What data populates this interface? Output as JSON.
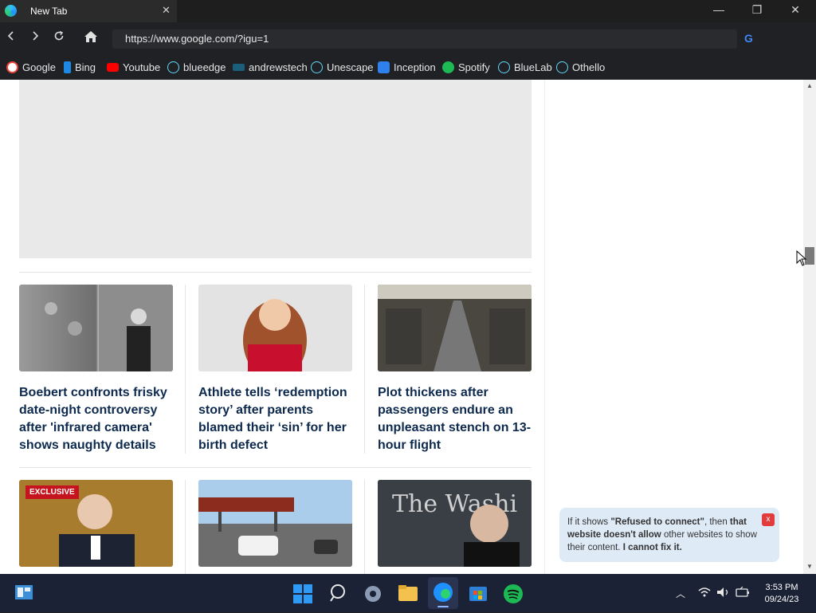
{
  "browser": {
    "tab_title": "New Tab",
    "url": "https://www.google.com/?igu=1"
  },
  "bookmarks": [
    {
      "label": "Google",
      "icon": "google-icon",
      "color": "#ea4335"
    },
    {
      "label": "Bing",
      "icon": "bing-icon",
      "color": "#1e88e5"
    },
    {
      "label": "Youtube",
      "icon": "youtube-icon",
      "color": "#ff0000"
    },
    {
      "label": "blueedge",
      "icon": "react-icon",
      "color": "#61dafb"
    },
    {
      "label": "andrewstech",
      "icon": "andrewstech-icon",
      "color": "#1b5f7a"
    },
    {
      "label": "Unescape",
      "icon": "react-icon",
      "color": "#61dafb"
    },
    {
      "label": "Inception",
      "icon": "inception-icon",
      "color": "#2f80ed"
    },
    {
      "label": "Spotify",
      "icon": "spotify-icon",
      "color": "#1db954"
    },
    {
      "label": "BlueLab",
      "icon": "react-icon",
      "color": "#61dafb"
    },
    {
      "label": "Othello",
      "icon": "react-icon",
      "color": "#61dafb"
    }
  ],
  "articles": [
    {
      "title": "Boebert confronts frisky date-night controversy after 'infrared camera' shows naughty details"
    },
    {
      "title": "Athlete tells ‘redemption story’ after parents blamed their ‘sin’ for her birth defect"
    },
    {
      "title": "Plot thickens after passengers endure an unpleasant stench on 13-hour flight"
    }
  ],
  "row2": {
    "badge": "EXCLUSIVE"
  },
  "notice": {
    "prefix": "If it shows ",
    "strong1": "\"Refused to connect\"",
    "mid": ", then ",
    "strong2": "that website doesn't allow",
    "mid2": " other websites to show their content. ",
    "strong3": "I cannot fix it.",
    "close": "x"
  },
  "taskbar": {
    "time": "3:53 PM",
    "date": "09/24/23"
  }
}
